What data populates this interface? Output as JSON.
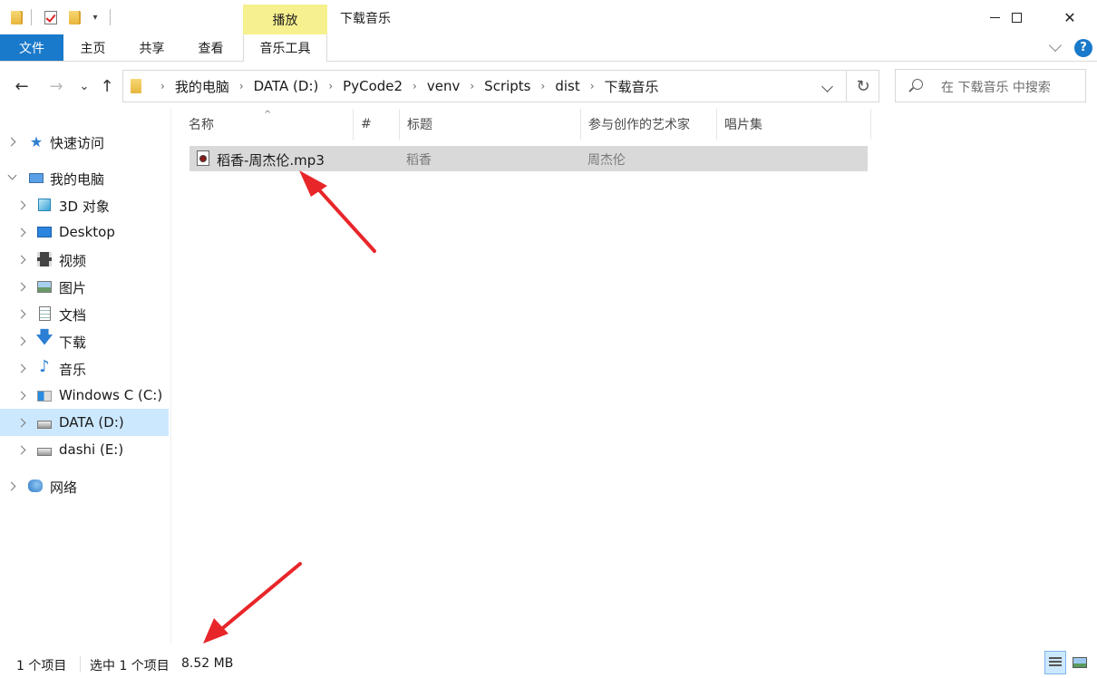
{
  "window": {
    "title": "下载音乐",
    "context_tab_header": "播放",
    "minimize_icon": "minimize-icon",
    "maximize_icon": "maximize-icon",
    "close_glyph": "✕"
  },
  "ribbon": {
    "tabs": [
      {
        "label": "文件"
      },
      {
        "label": "主页"
      },
      {
        "label": "共享"
      },
      {
        "label": "查看"
      },
      {
        "label": "音乐工具"
      }
    ],
    "help_glyph": "?"
  },
  "nav": {
    "back_glyph": "←",
    "forward_glyph": "→",
    "recent_glyph": "⌄",
    "up_glyph": "↑",
    "refresh_glyph": "↻"
  },
  "address": {
    "crumbs": [
      "我的电脑",
      "DATA (D:)",
      "PyCode2",
      "venv",
      "Scripts",
      "dist",
      "下载音乐"
    ],
    "separator": "›"
  },
  "search": {
    "placeholder": "在 下载音乐 中搜索"
  },
  "sidebar": {
    "items": [
      {
        "label": "快速访问",
        "icon": "star-icon"
      },
      {
        "label": "我的电脑",
        "icon": "computer-icon"
      },
      {
        "label": "3D 对象",
        "icon": "cube-icon"
      },
      {
        "label": "Desktop",
        "icon": "desktop-icon"
      },
      {
        "label": "视频",
        "icon": "film-icon"
      },
      {
        "label": "图片",
        "icon": "picture-icon"
      },
      {
        "label": "文档",
        "icon": "document-icon"
      },
      {
        "label": "下载",
        "icon": "download-icon"
      },
      {
        "label": "音乐",
        "icon": "music-icon"
      },
      {
        "label": "Windows C (C:)",
        "icon": "windows-drive-icon"
      },
      {
        "label": "DATA (D:)",
        "icon": "drive-icon"
      },
      {
        "label": "dashi (E:)",
        "icon": "drive-icon"
      },
      {
        "label": "网络",
        "icon": "network-icon"
      }
    ],
    "selected": "DATA (D:)"
  },
  "columns": [
    {
      "label": "名称"
    },
    {
      "label": "#"
    },
    {
      "label": "标题"
    },
    {
      "label": "参与创作的艺术家"
    },
    {
      "label": "唱片集"
    }
  ],
  "files": [
    {
      "name": "稻香-周杰伦.mp3",
      "number": "",
      "title": "稻香",
      "artist": "周杰伦",
      "album": "",
      "icon": "audio-file-icon"
    }
  ],
  "status": {
    "count": "1 个项目",
    "selected": "选中 1 个项目",
    "size": "8.52 MB"
  },
  "colors": {
    "accent": "#1979ca",
    "context_tab": "#f7f08e",
    "selection": "#cce8ff",
    "row_selected": "#d9d9d9",
    "annotation_arrow": "#e8262a"
  }
}
